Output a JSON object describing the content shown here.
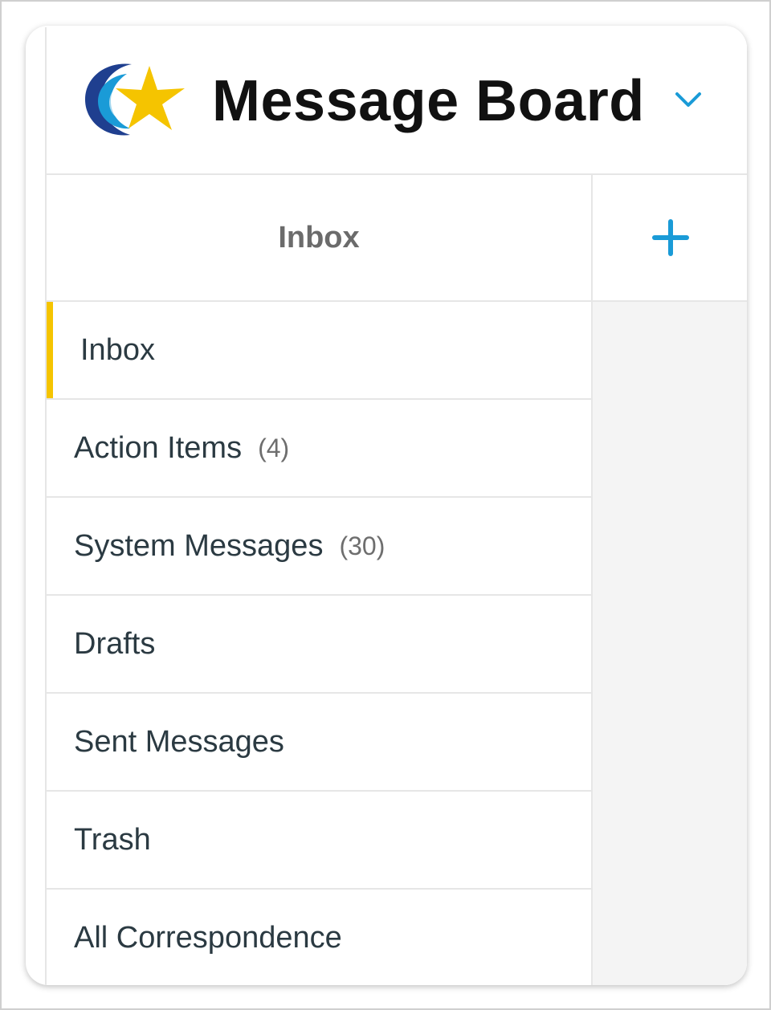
{
  "header": {
    "title": "Message Board",
    "logo_icon": "star-swoosh-logo",
    "chevron_icon": "chevron-down-icon",
    "accent_color": "#1a9bd7"
  },
  "tabbar": {
    "current_label": "Inbox",
    "add_icon": "plus-icon"
  },
  "folders": [
    {
      "label": "Inbox",
      "count": "",
      "active": true
    },
    {
      "label": "Action Items",
      "count": "(4)",
      "active": false
    },
    {
      "label": "System Messages",
      "count": "(30)",
      "active": false
    },
    {
      "label": "Drafts",
      "count": "",
      "active": false
    },
    {
      "label": "Sent Messages",
      "count": "",
      "active": false
    },
    {
      "label": "Trash",
      "count": "",
      "active": false
    },
    {
      "label": "All Correspondence",
      "count": "",
      "active": false
    }
  ],
  "colors": {
    "active_indicator": "#f5c400",
    "divider": "#e6e6e6",
    "pane_background": "#f4f4f4"
  }
}
